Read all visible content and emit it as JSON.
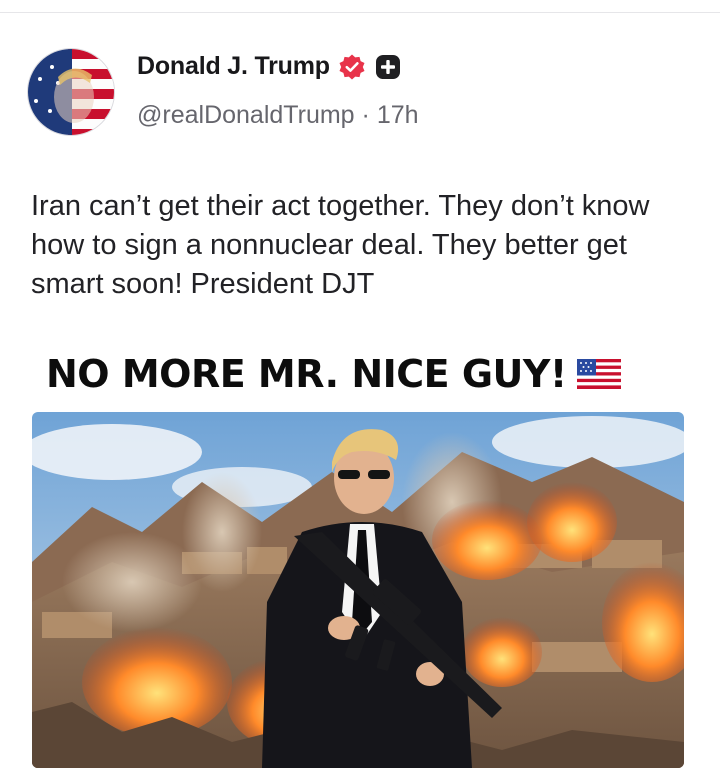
{
  "post": {
    "author_name": "Donald J. Trump",
    "handle": "@realDonaldTrump",
    "separator": "·",
    "time": "17h",
    "text": "Iran can’t get their act together. They don’t know how to sign a nonnuclear deal. They better get smart soon! President DJT"
  },
  "image": {
    "headline": "NO MORE MR. NICE GUY!",
    "flag_icon": "us-flag-icon"
  },
  "colors": {
    "verified_badge": "#e8334a",
    "plus_badge": "#1f1f22",
    "handle_gray": "#66666d"
  }
}
